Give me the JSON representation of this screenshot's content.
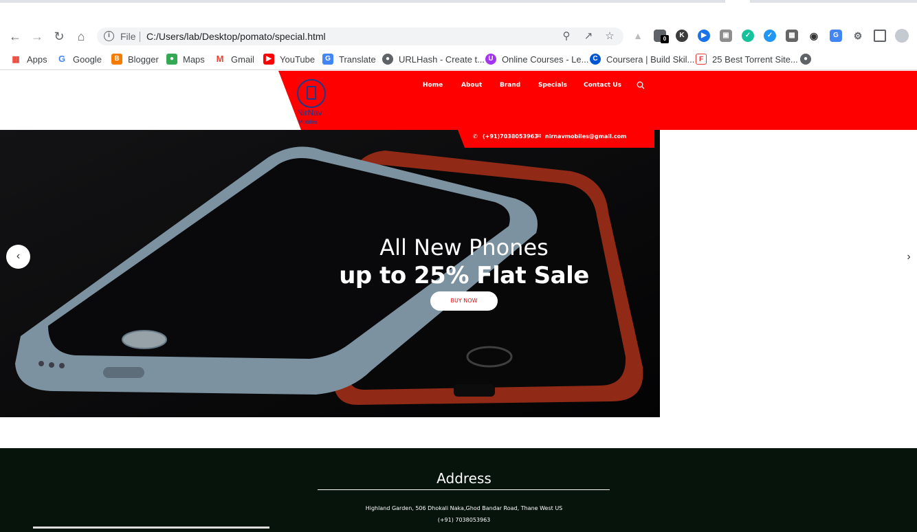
{
  "browser": {
    "url_scheme_label": "File",
    "url": "C:/Users/lab/Desktop/pomato/special.html",
    "extension_badge": "0",
    "bookmarks": [
      {
        "label": "Apps",
        "icon": "apps-grid-icon"
      },
      {
        "label": "Google",
        "icon": "google-icon"
      },
      {
        "label": "Blogger",
        "icon": "blogger-icon"
      },
      {
        "label": "Maps",
        "icon": "maps-icon"
      },
      {
        "label": "Gmail",
        "icon": "gmail-icon"
      },
      {
        "label": "YouTube",
        "icon": "youtube-icon"
      },
      {
        "label": "Translate",
        "icon": "translate-icon"
      },
      {
        "label": "URLHash - Create t...",
        "icon": "globe-icon"
      },
      {
        "label": "Online Courses - Le...",
        "icon": "udemy-icon"
      },
      {
        "label": "Coursera | Build Skil...",
        "icon": "coursera-icon"
      },
      {
        "label": "25 Best Torrent Site...",
        "icon": "torrent-icon"
      }
    ]
  },
  "site": {
    "logo_name": "NirNav",
    "logo_sub": "Mobiles",
    "nav": [
      "Home",
      "About",
      "Brand",
      "Specials",
      "Contact Us"
    ],
    "phone": "(+91)7038053963",
    "email": "nirnavmobiles@gmail.com",
    "hero": {
      "line1": "All New Phones",
      "line2": "up to 25% Flat Sale",
      "button": "BUY NOW"
    },
    "footer": {
      "title": "Address",
      "address": "Highland Garden, 506 Dhokali Naka,Ghod Bandar Road, Thane West US",
      "phone": "(+91) 7038053963"
    }
  },
  "colors": {
    "brand_red": "#ff0000",
    "footer_bg": "#06140c",
    "button_text": "#e00000"
  }
}
